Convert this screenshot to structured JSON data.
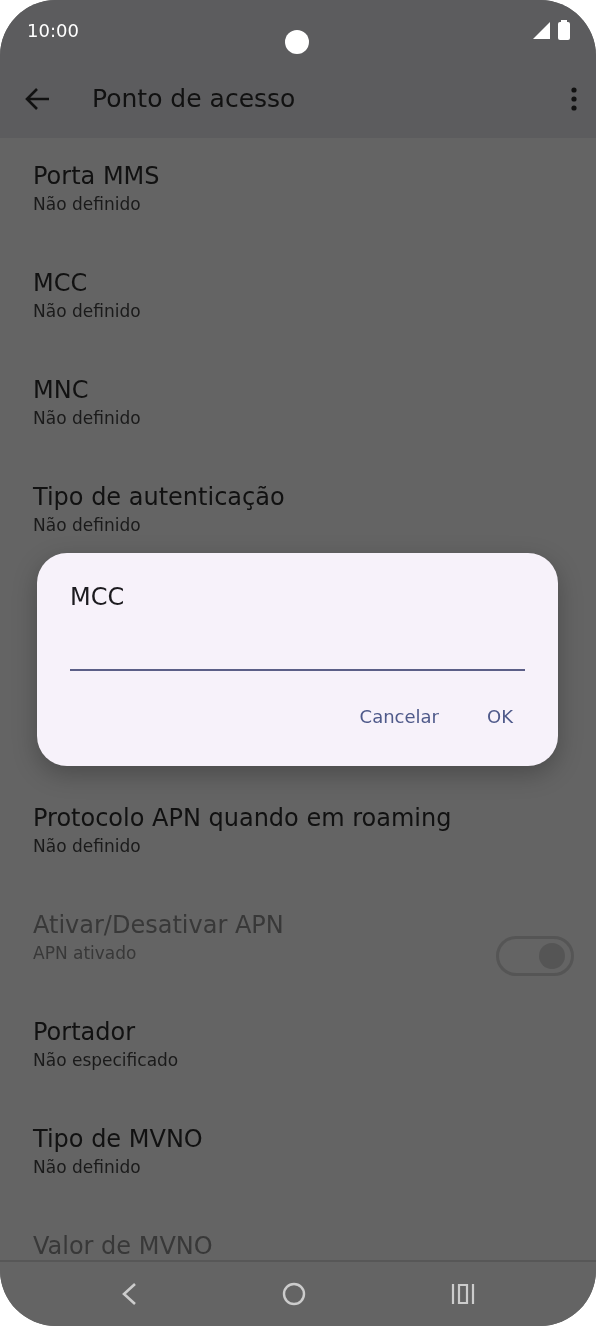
{
  "status_bar": {
    "time": "10:00"
  },
  "app_bar": {
    "title": "Ponto de acesso"
  },
  "settings": [
    {
      "kind": "text",
      "title": "Porta MMS",
      "summary": "Não definido",
      "disabled": false
    },
    {
      "kind": "text",
      "title": "MCC",
      "summary": "Não definido",
      "disabled": false
    },
    {
      "kind": "text",
      "title": "MNC",
      "summary": "Não definido",
      "disabled": false
    },
    {
      "kind": "text",
      "title": "Tipo de autenticação",
      "summary": "Não definido",
      "disabled": false
    },
    {
      "kind": "hidden"
    },
    {
      "kind": "hidden"
    },
    {
      "kind": "text",
      "title": "Protocolo APN quando em roaming",
      "summary": "Não definido",
      "disabled": false
    },
    {
      "kind": "toggle",
      "title": "Ativar/Desativar APN",
      "summary": "APN ativado",
      "disabled": true,
      "on": true
    },
    {
      "kind": "text",
      "title": "Portador",
      "summary": "Não especificado",
      "disabled": false
    },
    {
      "kind": "text",
      "title": "Tipo de MVNO",
      "summary": "Não definido",
      "disabled": false
    },
    {
      "kind": "text",
      "title": "Valor de MVNO",
      "disabled": true
    }
  ],
  "dialog": {
    "title": "MCC",
    "buttons": [
      "Cancelar",
      "OK"
    ]
  }
}
